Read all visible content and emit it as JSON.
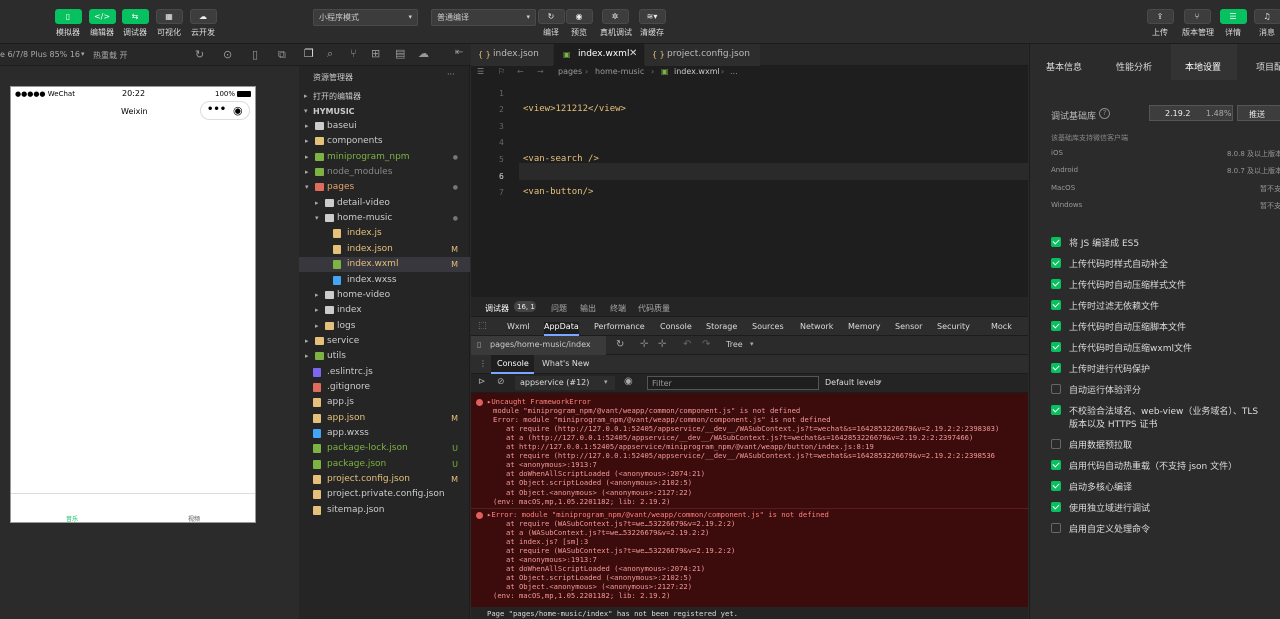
{
  "toolbar": {
    "simulator": "模拟器",
    "editor": "编辑器",
    "debugger": "调试器",
    "visual": "可视化",
    "cloud": "云开发",
    "mode_select": "小程序模式",
    "compile_select": "普通编译",
    "compile": "编译",
    "preview": "预览",
    "device_debug": "真机调试",
    "clear_cache": "清缓存",
    "upload": "上传",
    "version": "版本管理",
    "details": "详情",
    "messages": "消息"
  },
  "sim_bar": {
    "device": "e 6/7/8 Plus 85% 16",
    "hot_reload": "热重载 开"
  },
  "phone": {
    "carrier": "●●●●● WeChat",
    "time": "20:22",
    "battery": "100%",
    "title": "Weixin",
    "tab1": "音乐",
    "tab2": "视频"
  },
  "explorer": {
    "title": "资源管理器",
    "open_editors": "打开的编辑器",
    "project": "HYMUSIC",
    "files": [
      {
        "name": "baseui",
        "status": ""
      },
      {
        "name": "components",
        "status": ""
      },
      {
        "name": "miniprogram_npm",
        "status": ""
      },
      {
        "name": "node_modules",
        "status": ""
      },
      {
        "name": "pages",
        "status": ""
      },
      {
        "name": "detail-video",
        "status": ""
      },
      {
        "name": "home-music",
        "status": ""
      },
      {
        "name": "index.js",
        "status": ""
      },
      {
        "name": "index.json",
        "status": "M"
      },
      {
        "name": "index.wxml",
        "status": "M"
      },
      {
        "name": "index.wxss",
        "status": ""
      },
      {
        "name": "home-video",
        "status": ""
      },
      {
        "name": "index",
        "status": ""
      },
      {
        "name": "logs",
        "status": ""
      },
      {
        "name": "service",
        "status": ""
      },
      {
        "name": "utils",
        "status": ""
      },
      {
        "name": ".eslintrc.js",
        "status": ""
      },
      {
        "name": ".gitignore",
        "status": ""
      },
      {
        "name": "app.js",
        "status": ""
      },
      {
        "name": "app.json",
        "status": "M"
      },
      {
        "name": "app.wxss",
        "status": ""
      },
      {
        "name": "package-lock.json",
        "status": "U"
      },
      {
        "name": "package.json",
        "status": "U"
      },
      {
        "name": "project.config.json",
        "status": "M"
      },
      {
        "name": "project.private.config.json",
        "status": ""
      },
      {
        "name": "sitemap.json",
        "status": ""
      }
    ]
  },
  "editor": {
    "tabs": [
      {
        "label": "index.json"
      },
      {
        "label": "index.wxml"
      },
      {
        "label": "project.config.json"
      }
    ],
    "breadcrumb": [
      "pages",
      "home-music",
      "index.wxml",
      "..."
    ],
    "lines": [
      {
        "num": "1",
        "code": ""
      },
      {
        "num": "2",
        "code": "<view>121212</view>"
      },
      {
        "num": "3",
        "code": ""
      },
      {
        "num": "4",
        "code": ""
      },
      {
        "num": "5",
        "code": "<van-search />"
      },
      {
        "num": "6",
        "code": ""
      },
      {
        "num": "7",
        "code": "<van-button/>"
      }
    ]
  },
  "debug": {
    "top_tabs": [
      "调试器",
      "16, 1",
      "问题",
      "输出",
      "终端",
      "代码质量"
    ],
    "panel_tabs": [
      "Wxml",
      "AppData",
      "Performance",
      "Console",
      "Storage",
      "Sources",
      "Network",
      "Memory",
      "Sensor",
      "Security",
      "Mock"
    ],
    "page_path": "pages/home-music/index",
    "tree": "Tree",
    "sub_tabs": [
      "Console",
      "What's New"
    ],
    "context": "appservice (#12)",
    "filter_placeholder": "Filter",
    "levels": "Default levels",
    "error1": [
      "▸Uncaught FrameworkError",
      "module \"miniprogram_npm/@vant/weapp/common/component.js\" is not defined",
      "Error: module \"miniprogram_npm/@vant/weapp/common/component.js\" is not defined",
      "    at require (http://127.0.0.1:52405/appservice/__dev__/WASubContext.js?t=wechat&s=1642853226679&v=2.19.2:2:2398303)",
      "    at a (http://127.0.0.1:52405/appservice/__dev__/WASubContext.js?t=wechat&s=1642853226679&v=2.19.2:2:2397466)",
      "    at http://127.0.0.1:52405/appservice/miniprogram_npm/@vant/weapp/button/index.js:8:19",
      "    at require (http://127.0.0.1:52405/appservice/__dev__/WASubContext.js?t=wechat&s=1642853226679&v=2.19.2:2:2398536",
      "    at <anonymous>:1913:7",
      "    at doWhenAllScriptLoaded (<anonymous>:2074:21)",
      "    at Object.scriptLoaded (<anonymous>:2102:5)",
      "    at Object.<anonymous> (<anonymous>:2127:22)",
      "(env: macOS,mp,1.05.2201182; lib: 2.19.2)"
    ],
    "error2": [
      "▸Error: module \"miniprogram_npm/@vant/weapp/common/component.js\" is not defined",
      "    at require (WASubContext.js?t=we…53226679&v=2.19.2:2)",
      "    at a (WASubContext.js?t=we…53226679&v=2.19.2:2)",
      "    at index.js? [sm]:3",
      "    at require (WASubContext.js?t=we…53226679&v=2.19.2:2)",
      "    at <anonymous>:1913:7",
      "    at doWhenAllScriptLoaded (<anonymous>:2074:21)",
      "    at Object.scriptLoaded (<anonymous>:2102:5)",
      "    at Object.<anonymous> (<anonymous>:2127:22)",
      "(env: macOS,mp,1.05.2201182; lib: 2.19.2)"
    ],
    "last_line": "Page \"pages/home-music/index\" has not been registered yet."
  },
  "right": {
    "tabs": [
      "基本信息",
      "性能分析",
      "本地设置",
      "项目配"
    ],
    "lib_label": "调试基础库",
    "lib_version": "2.19.2",
    "lib_percent": "1.48%",
    "push": "推送",
    "support_title": "该基础库支持微信客户端",
    "platforms": [
      {
        "name": "iOS",
        "value": "8.0.8 及以上版本"
      },
      {
        "name": "Android",
        "value": "8.0.7 及以上版本"
      },
      {
        "name": "MacOS",
        "value": "暂不支"
      },
      {
        "name": "Windows",
        "value": "暂不支"
      }
    ],
    "options": [
      {
        "label": "将 JS 编译成 ES5",
        "checked": true
      },
      {
        "label": "上传代码时样式自动补全",
        "checked": true
      },
      {
        "label": "上传代码时自动压缩样式文件",
        "checked": true
      },
      {
        "label": "上传时过滤无依赖文件",
        "checked": true
      },
      {
        "label": "上传代码时自动压缩脚本文件",
        "checked": true
      },
      {
        "label": "上传代码时自动压缩wxml文件",
        "checked": true
      },
      {
        "label": "上传时进行代码保护",
        "checked": true
      },
      {
        "label": "自动运行体验评分",
        "checked": false
      },
      {
        "label": "不校验合法域名、web-view（业务域名）、TLS",
        "label2": "版本以及 HTTPS 证书",
        "checked": true
      },
      {
        "label": "启用数据预拉取",
        "checked": false
      },
      {
        "label": "启用代码自动热重载（不支持 json 文件）",
        "checked": true
      },
      {
        "label": "启动多核心编译",
        "checked": true
      },
      {
        "label": "使用独立域进行调试",
        "checked": true
      },
      {
        "label": "启用自定义处理命令",
        "checked": false
      }
    ]
  },
  "colors": {
    "green": "#07c160",
    "error_bg": "#3c0b0b",
    "error_text": "#f39a9a"
  }
}
